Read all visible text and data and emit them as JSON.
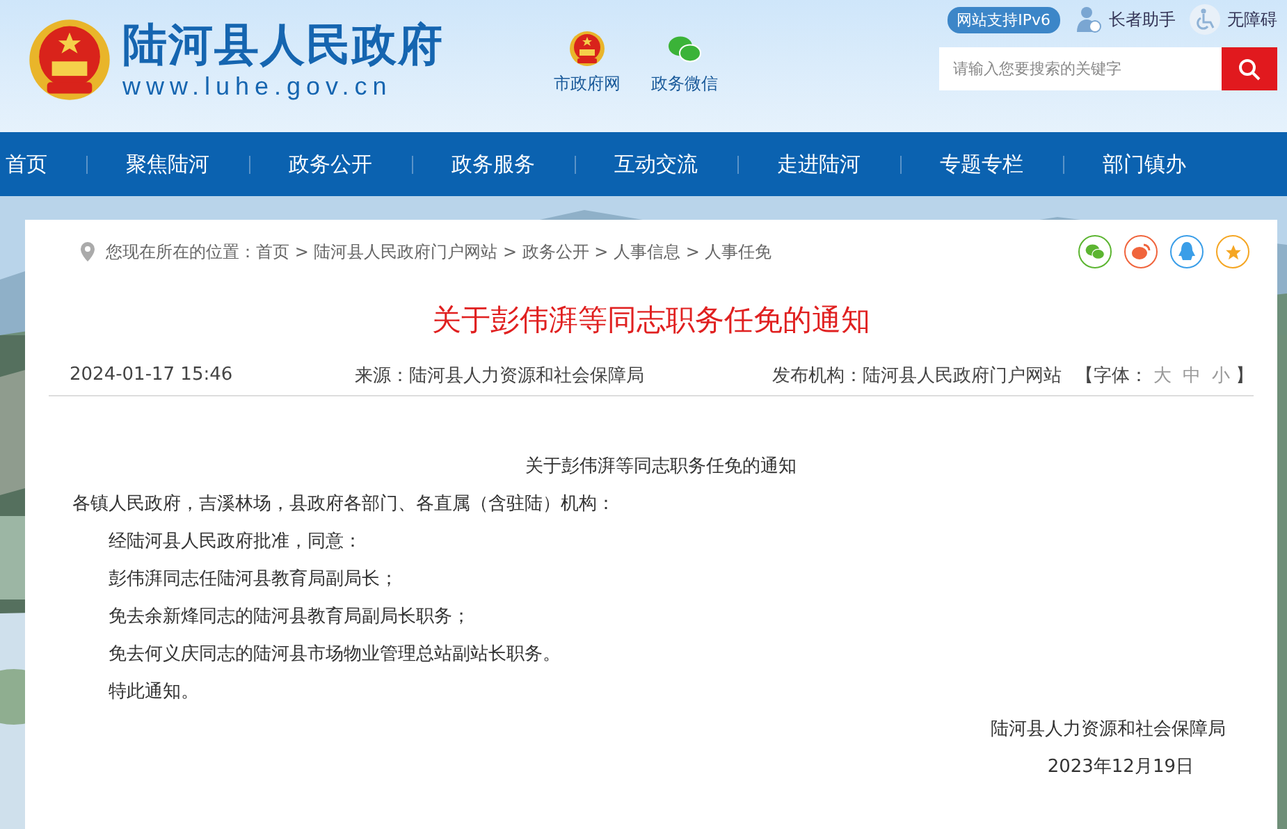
{
  "header": {
    "site_name": "陆河县人民政府",
    "site_url": "www.luhe.gov.cn",
    "quick_links": [
      {
        "label": "市政府网",
        "kind": "emblem"
      },
      {
        "label": "政务微信",
        "kind": "wechat"
      }
    ],
    "ipv6_badge": "网站支持IPv6",
    "tools": [
      {
        "label": "长者助手",
        "kind": "elder"
      },
      {
        "label": "无障碍",
        "kind": "accessible"
      }
    ],
    "search": {
      "placeholder": "请输入您要搜索的关键字"
    }
  },
  "nav": {
    "items": [
      {
        "label": "首页"
      },
      {
        "label": "聚焦陆河"
      },
      {
        "label": "政务公开"
      },
      {
        "label": "政务服务"
      },
      {
        "label": "互动交流"
      },
      {
        "label": "走进陆河"
      },
      {
        "label": "专题专栏"
      },
      {
        "label": "部门镇办"
      }
    ]
  },
  "breadcrumb": "您现在所在的位置：首页 > 陆河县人民政府门户网站 > 政务公开 > 人事信息 > 人事任免",
  "share": [
    {
      "kind": "wechat",
      "color": "#5cb531"
    },
    {
      "kind": "weibo",
      "color": "#f0643c"
    },
    {
      "kind": "qq",
      "color": "#3a9ee8"
    },
    {
      "kind": "favorite",
      "color": "#f5a623"
    }
  ],
  "article": {
    "title": "关于彭伟湃等同志职务任免的通知",
    "date": "2024-01-17 15:46",
    "source_label": "来源：",
    "source": "陆河县人力资源和社会保障局",
    "publisher_label": "发布机构：",
    "publisher": "陆河县人民政府门户网站",
    "font_label": "【字体：",
    "font_sizes": [
      "大",
      "中",
      "小"
    ],
    "font_close": "】",
    "body": {
      "heading": "关于彭伟湃等同志职务任免的通知",
      "salutation": "各镇人民政府，吉溪林场，县政府各部门、各直属（含驻陆）机构：",
      "paragraphs": [
        "经陆河县人民政府批准，同意：",
        "彭伟湃同志任陆河县教育局副局长；",
        "免去余新烽同志的陆河县教育局副局长职务；",
        "免去何义庆同志的陆河县市场物业管理总站副站长职务。",
        "特此通知。"
      ],
      "signature": "陆河县人力资源和社会保障局",
      "sign_date": "2023年12月19日"
    }
  }
}
